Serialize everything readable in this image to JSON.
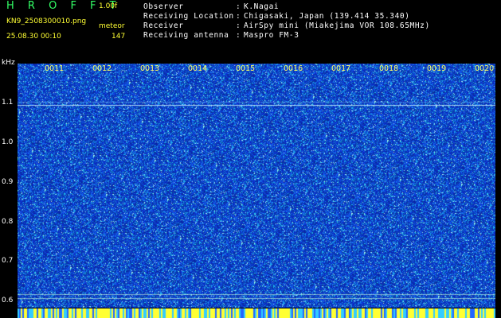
{
  "app": {
    "title": "H R O F F T",
    "version": "1.00f"
  },
  "file": {
    "name": "KN9_2508300010.png",
    "datetime": "25.08.30 00:10",
    "mode": "meteor",
    "count": "147"
  },
  "station": {
    "rows": [
      {
        "label": "Observer",
        "value": "K.Nagai"
      },
      {
        "label": "Receiving Location",
        "value": "Chigasaki, Japan (139.414 35.340)"
      },
      {
        "label": "Receiver",
        "value": "AirSpy mini (Miakejima VOR 108.65MHz)"
      },
      {
        "label": "Receiving antenna",
        "value": "Maspro FM-3"
      }
    ]
  },
  "axis": {
    "y_unit": "kHz",
    "y_ticks": [
      "1.1",
      "1.0",
      "0.9",
      "0.8",
      "0.7",
      "0.6"
    ],
    "x_ticks": [
      "0011",
      "0012",
      "0013",
      "0014",
      "0015",
      "0016",
      "0017",
      "0018",
      "0019",
      "0020"
    ]
  },
  "colors": {
    "background": "#000000",
    "noise_base": "#0a2fa8",
    "title": "#33ff66",
    "accent": "#ffff33"
  }
}
